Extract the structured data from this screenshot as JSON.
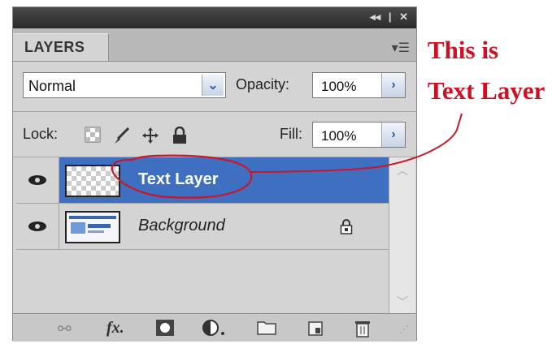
{
  "panel": {
    "title_controls": [
      "◂◂",
      "|",
      "✕"
    ],
    "tab_label": "LAYERS",
    "menu_icon": "panel-menu-icon"
  },
  "blend": {
    "mode": "Normal"
  },
  "opacity": {
    "label": "Opacity:",
    "value": "100%"
  },
  "lock": {
    "label": "Lock:"
  },
  "fill": {
    "label": "Fill:",
    "value": "100%"
  },
  "layers": [
    {
      "name": "Text Layer",
      "selected": true,
      "visible": true,
      "locked": false
    },
    {
      "name": "Background",
      "selected": false,
      "visible": true,
      "locked": true
    }
  ],
  "bottom_tools": [
    "link-icon",
    "fx-icon",
    "mask-icon",
    "adjustment-icon",
    "folder-icon",
    "new-layer-icon",
    "trash-icon"
  ],
  "annotation": {
    "line1": "This is",
    "line2": "Text Layer",
    "color": "#d01020"
  },
  "colors": {
    "selection": "#3f6fc0",
    "panel": "#d4d4d4"
  }
}
